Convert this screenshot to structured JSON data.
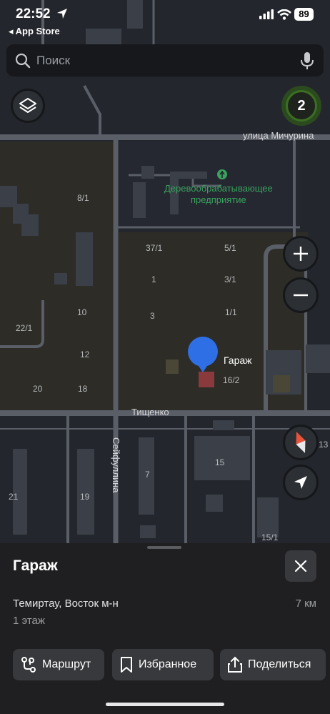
{
  "status_bar": {
    "time": "22:52",
    "back_app": "◂ App Store",
    "battery": "89",
    "icons": [
      "location-arrow-icon",
      "cellular-signal-icon",
      "wifi-icon",
      "battery-icon"
    ]
  },
  "search": {
    "placeholder": "Поиск",
    "icons": [
      "search-icon",
      "microphone-icon"
    ]
  },
  "map": {
    "controls": [
      "layers-icon",
      "plus-icon",
      "minus-icon",
      "compass-icon",
      "navigation-arrow-icon"
    ],
    "cluster_count": "2",
    "streets": {
      "michurina": "улица Мичурина",
      "tishchenko": "Тищенко",
      "seifullina": "Сейфуллина"
    },
    "poi": {
      "line1": "Деревообрабатывающее",
      "line2": "предприятие",
      "icon": "tree-icon"
    },
    "pin_label": "Гараж",
    "house_numbers": [
      "8/1",
      "37/1",
      "5/1",
      "1",
      "3/1",
      "22/1",
      "10",
      "3",
      "1/1",
      "12",
      "20",
      "18",
      "16/2",
      "15",
      "7",
      "21",
      "19",
      "13",
      "15/1"
    ],
    "colors": {
      "background": "#2a2d33",
      "block": "#2d2c27",
      "road": "#5a5e67",
      "building": "#3b4048",
      "pin": "#2f6fe6",
      "garage": "#8a3a3c",
      "poi": "#3aa35f"
    }
  },
  "sheet": {
    "title": "Гараж",
    "address": "Темиртау, Восток м-н",
    "distance": "7 км",
    "floor": "1 этаж",
    "buttons": {
      "route": "Маршрут",
      "favorites": "Избранное",
      "share": "Поделиться"
    },
    "icons": [
      "close-icon",
      "route-icon",
      "bookmark-icon",
      "share-icon"
    ]
  }
}
